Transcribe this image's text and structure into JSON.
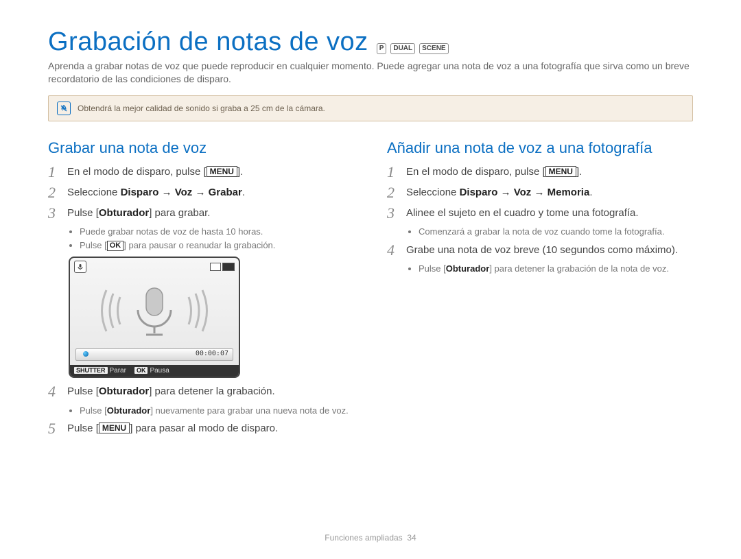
{
  "title": "Grabación de notas de voz",
  "intro": "Aprenda a grabar notas de voz que puede reproducir en cualquier momento. Puede agregar una nota de voz a una fotografía que sirva como un breve recordatorio de las condiciones de disparo.",
  "note": "Obtendrá la mejor calidad de sonido si graba a 25 cm de la cámara.",
  "mode_icons": [
    "P",
    "DUAL",
    "SCENE"
  ],
  "left": {
    "head": "Grabar una nota de voz",
    "steps": {
      "s1_pre": "En el modo de disparo, pulse [",
      "s1_menu": "MENU",
      "s1_post": "].",
      "s2_pre": "Seleccione ",
      "s2_bold": "Disparo → Voz → Grabar",
      "s2_post": ".",
      "s3_pre": "Pulse [",
      "s3_bold": "Obturador",
      "s3_post": "] para grabar.",
      "s3_b1": "Puede grabar notas de voz de hasta 10 horas.",
      "s3_b2_pre": "Pulse [",
      "s3_b2_ok": "OK",
      "s3_b2_post": "] para pausar o reanudar la grabación.",
      "s4_pre": "Pulse [",
      "s4_bold": "Obturador",
      "s4_post": "] para detener la grabación.",
      "s4_b1_pre": "Pulse [",
      "s4_b1_bold": "Obturador",
      "s4_b1_post": "] nuevamente para grabar una nueva nota de voz.",
      "s5_pre": "Pulse [",
      "s5_menu": "MENU",
      "s5_post": "] para pasar al modo de disparo."
    },
    "screen": {
      "time": "00:00:07",
      "shutter_btn": "SHUTTER",
      "shutter_lbl": "Parar",
      "ok_btn": "OK",
      "ok_lbl": "Pausa"
    }
  },
  "right": {
    "head": "Añadir una nota de voz a una fotografía",
    "steps": {
      "s1_pre": "En el modo de disparo, pulse [",
      "s1_menu": "MENU",
      "s1_post": "].",
      "s2_pre": "Seleccione ",
      "s2_bold": "Disparo → Voz → Memoria",
      "s2_post": ".",
      "s3": "Alinee el sujeto en el cuadro y tome una fotografía.",
      "s3_b1": "Comenzará a grabar la nota de voz cuando tome la fotografía.",
      "s4": "Grabe una nota de voz breve (10 segundos como máximo).",
      "s4_b1_pre": "Pulse [",
      "s4_b1_bold": "Obturador",
      "s4_b1_post": "] para detener la grabación de la nota de voz."
    }
  },
  "footer_label": "Funciones ampliadas",
  "footer_page": "34"
}
